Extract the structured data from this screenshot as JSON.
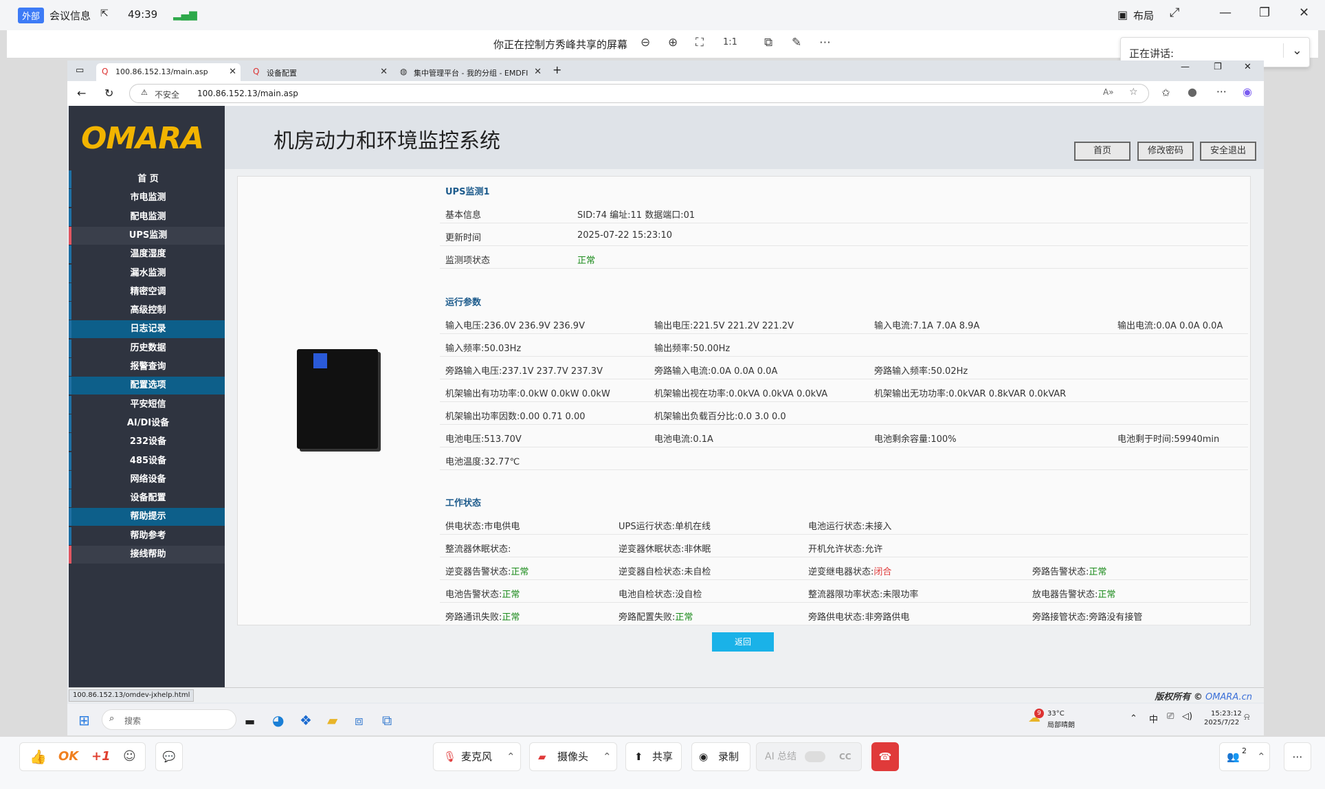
{
  "meeting_bar": {
    "tag": "外部",
    "info": "会议信息",
    "timer": "49:39",
    "layout": "布局"
  },
  "share_bar": {
    "title": "你正在控制方秀峰共享的屏幕"
  },
  "speaking": {
    "label": "正在讲话:"
  },
  "browser": {
    "tabs": [
      {
        "label": "100.86.152.13/main.asp"
      },
      {
        "label": "设备配置"
      },
      {
        "label": "集中管理平台 - 我的分组 - EMDFI"
      }
    ],
    "insecure": "不安全",
    "url": "100.86.152.13/main.asp"
  },
  "app": {
    "logo": "OMARA",
    "title": "机房动力和环境监控系统",
    "buttons": [
      "首页",
      "修改密码",
      "安全退出"
    ]
  },
  "nav": [
    {
      "label": "首 页",
      "type": "item"
    },
    {
      "label": "市电监测",
      "type": "item"
    },
    {
      "label": "配电监测",
      "type": "item"
    },
    {
      "label": "UPS监测",
      "type": "red"
    },
    {
      "label": "温度湿度",
      "type": "item"
    },
    {
      "label": "漏水监测",
      "type": "item"
    },
    {
      "label": "精密空调",
      "type": "item"
    },
    {
      "label": "高级控制",
      "type": "item"
    },
    {
      "label": "日志记录",
      "type": "sec"
    },
    {
      "label": "历史数据",
      "type": "item"
    },
    {
      "label": "报警查询",
      "type": "item"
    },
    {
      "label": "配置选项",
      "type": "sec"
    },
    {
      "label": "平安短信",
      "type": "item"
    },
    {
      "label": "AI/DI设备",
      "type": "item"
    },
    {
      "label": "232设备",
      "type": "item"
    },
    {
      "label": "485设备",
      "type": "item"
    },
    {
      "label": "网络设备",
      "type": "item"
    },
    {
      "label": "设备配置",
      "type": "item"
    },
    {
      "label": "帮助提示",
      "type": "sec"
    },
    {
      "label": "帮助参考",
      "type": "item"
    },
    {
      "label": "接线帮助",
      "type": "red"
    }
  ],
  "ups": {
    "section1": "UPS监测1",
    "basic_label": "基本信息",
    "basic_value": "SID:74   编址:11   数据端口:01",
    "update_label": "更新时间",
    "update_value": "2025-07-22 15:23:10",
    "status_label": "监测项状态",
    "status_value": "正常",
    "section2": "运行参数",
    "params": [
      [
        "输入电压:236.0V 236.9V 236.9V",
        "输出电压:221.5V 221.2V 221.2V",
        "输入电流:7.1A 7.0A 8.9A",
        "输出电流:0.0A 0.0A 0.0A"
      ],
      [
        "输入频率:50.03Hz",
        "输出频率:50.00Hz",
        "",
        ""
      ],
      [
        "旁路输入电压:237.1V 237.7V 237.3V",
        "旁路输入电流:0.0A 0.0A 0.0A",
        "旁路输入频率:50.02Hz",
        ""
      ],
      [
        "机架输出有功功率:0.0kW 0.0kW 0.0kW",
        "机架输出视在功率:0.0kVA 0.0kVA 0.0kVA",
        "机架输出无功功率:0.0kVAR 0.8kVAR 0.0kVAR",
        ""
      ],
      [
        "机架输出功率因数:0.00 0.71 0.00",
        "机架输出负载百分比:0.0 3.0 0.0",
        "",
        ""
      ],
      [
        "电池电压:513.70V",
        "电池电流:0.1A",
        "电池剩余容量:100%",
        "电池剩于时间:59940min"
      ],
      [
        "电池温度:32.77℃",
        "",
        "",
        ""
      ]
    ],
    "section3": "工作状态",
    "work": [
      [
        [
          "供电状态:市电供电",
          ""
        ],
        [
          "UPS运行状态:单机在线",
          ""
        ],
        [
          "电池运行状态:未接入",
          ""
        ],
        [
          "",
          ""
        ]
      ],
      [
        [
          "整流器休眠状态:",
          ""
        ],
        [
          "逆变器休眠状态:非休眠",
          ""
        ],
        [
          "开机允许状态:允许",
          ""
        ],
        [
          "",
          ""
        ]
      ],
      [
        [
          "逆变器告警状态:",
          "正常"
        ],
        [
          "逆变器自检状态:未自检",
          ""
        ],
        [
          "逆变继电器状态:",
          "闭合"
        ],
        [
          "旁路告警状态:",
          "正常"
        ]
      ],
      [
        [
          "电池告警状态:",
          "正常"
        ],
        [
          "电池自检状态:没自检",
          ""
        ],
        [
          "整流器限功率状态:未限功率",
          ""
        ],
        [
          "放电器告警状态:",
          "正常"
        ]
      ],
      [
        [
          "旁路通讯失败:",
          "正常"
        ],
        [
          "旁路配置失败:",
          "正常"
        ],
        [
          "旁路供电状态:非旁路供电",
          ""
        ],
        [
          "旁路接管状态:旁路没有接管",
          ""
        ]
      ]
    ],
    "back": "返回"
  },
  "status_url": "100.86.152.13/omdev-jxhelp.html",
  "copyright": {
    "text": "版权所有 ©",
    "brand": "OMARA.cn"
  },
  "taskbar": {
    "search": "搜索",
    "weather_temp": "33°C",
    "weather_desc": "局部晴朗",
    "badge": "9",
    "ime": "中",
    "time": "15:23:12",
    "date": "2025/7/22"
  },
  "meeting_controls": {
    "ok": "OK",
    "plus": "+1",
    "mic": "麦克风",
    "cam": "摄像头",
    "share": "共享",
    "record": "录制",
    "ai": "AI 总结",
    "cc": "CC",
    "participants": "2"
  },
  "colors": {
    "accent": "#1ab2e8",
    "ok": "#1a8a1a",
    "alarm": "#e03a3a",
    "logo": "#f2b400"
  }
}
